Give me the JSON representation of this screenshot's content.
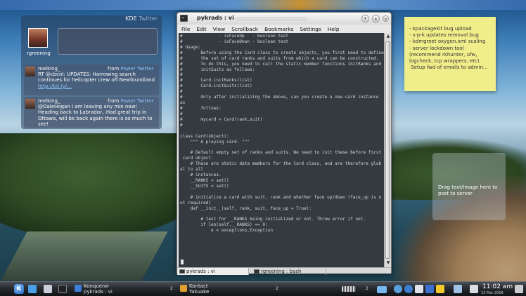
{
  "microblog": {
    "title": "KDE",
    "title_dim": "Twitter",
    "user": "rgreening",
    "tweets": [
      {
        "user": "melking_",
        "from_label": "from",
        "from_app": "Power Twitter",
        "text": "RT @cbcnl: UPDATES: Harrowing search continues for helicopter crew off Newfoundland",
        "link": "http://bit.ly/..."
      },
      {
        "user": "melking_",
        "from_label": "from",
        "from_app": "Power Twitter",
        "text": "@OaleHogan I am leaving any min now! Heading back to Labrador...Had great trip in Ottawa, will be back again there is so much to see!",
        "link": ""
      }
    ]
  },
  "note": {
    "text": "- kpackagekit bug upload\n- s-p-k updates removal bug\n- kdmgreet oxygen.xml scaling\n- server lockdown tool (recommend rkhunter, ufw, logcheck, tcp wrappers, etc).\n Setup fwd of emails to admin..."
  },
  "pastebin": {
    "text": "Drag text/image here to post to server"
  },
  "konsole": {
    "title": "pykrads : vi",
    "menu": [
      "File",
      "Edit",
      "View",
      "Scrollback",
      "Bookmarks",
      "Settings",
      "Help"
    ],
    "lines": [
      "#              - isFaceUp   - boolean test",
      "#              - isFaceDown - boolean test",
      "# Usage:",
      "#       Before using the Card class to create objects, you first need to define",
      "#       the set of card ranks and suits from which a card can be constructed.",
      "#       To do this, you need to call the static member functions initRanks and",
      "#       initSuits as follows:",
      "#",
      "#       Card.initRanks(list)",
      "#       Card.initSuits(list)",
      "#",
      "#       Only after initializing the above, can you create a new card instance",
      "as",
      "#       follows:",
      "#",
      "#       mycard = Card(rank,suit)",
      "#",
      "",
      "class Card(object):",
      "    \"\"\" A playing card. \"\"\"",
      "",
      "    # Default empty set of ranks and suits. We need to init these before first",
      " card object.",
      "    # These are static data members for the Card class, and are therefore glob",
      "al to all",
      "    # instances.",
      "    __RANKS = set()",
      "    __SUITS = set()",
      "",
      "    # initialize a card with suit, rank and whether face up/down (face_up is n",
      "ot required)",
      "    def __init__(self, rank, suit, face_up = True):",
      "",
      "        # test for __RANKS being initialized or not. Throw error if not.",
      "        if len(self.__RANKS) == 0:",
      "            e = exceptions.Exception",
      ""
    ],
    "tabs": [
      "pykrads : vi",
      "rgreening : bash"
    ]
  },
  "panel": {
    "tasks": [
      {
        "label": "Konqueror",
        "sub": "pykrads : vi",
        "count": "2"
      },
      {
        "label": "Kontact",
        "sub": "Yakuake",
        "count": "2"
      },
      {
        "label": "",
        "sub": "",
        "count": "2"
      }
    ],
    "clock": "11:02 am",
    "date": "13 Mar 2009"
  },
  "colors": {
    "note_bg": "#f0ee8a",
    "link": "#8ec4ff",
    "terminal_bg": "#1c222a"
  }
}
